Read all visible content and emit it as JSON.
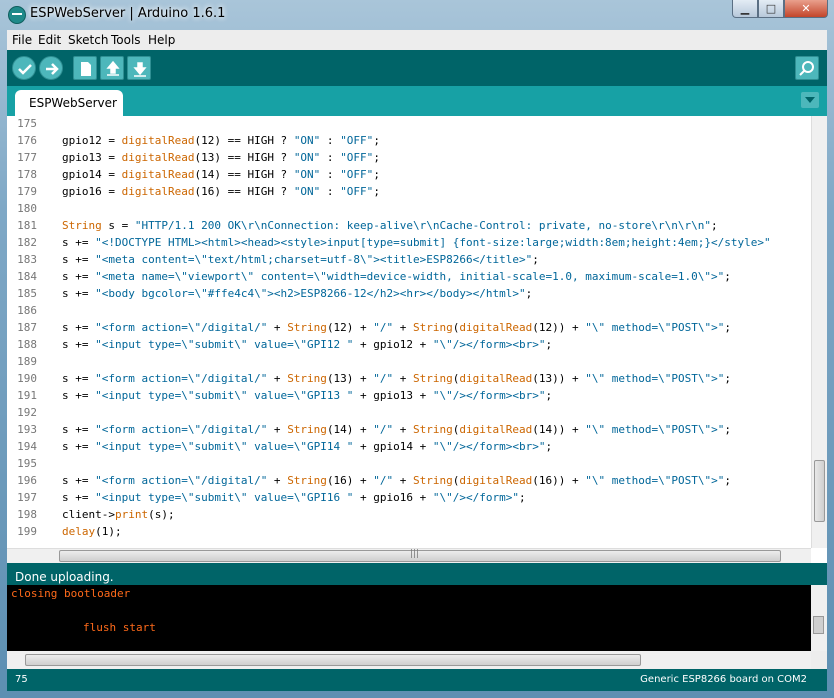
{
  "window": {
    "title": "ESPWebServer | Arduino 1.6.1"
  },
  "menu": [
    "File",
    "Edit",
    "Sketch",
    "Tools",
    "Help"
  ],
  "tab": {
    "label": "ESPWebServer"
  },
  "code_lines": [
    {
      "n": "175",
      "t": ""
    },
    {
      "n": "176",
      "t": "gpio12 = digitalRead(12) == HIGH ? \"ON\" : \"OFF\";"
    },
    {
      "n": "177",
      "t": "gpio13 = digitalRead(13) == HIGH ? \"ON\" : \"OFF\";"
    },
    {
      "n": "178",
      "t": "gpio14 = digitalRead(14) == HIGH ? \"ON\" : \"OFF\";"
    },
    {
      "n": "179",
      "t": "gpio16 = digitalRead(16) == HIGH ? \"ON\" : \"OFF\";"
    },
    {
      "n": "180",
      "t": ""
    },
    {
      "n": "181",
      "t": "String s = \"HTTP/1.1 200 OK\\r\\nConnection: keep-alive\\r\\nCache-Control: private, no-store\\r\\n\\r\\n\";"
    },
    {
      "n": "182",
      "t": "s += \"<!DOCTYPE HTML><html><head><style>input[type=submit] {font-size:large;width:8em;height:4em;}</style>\""
    },
    {
      "n": "183",
      "t": "s += \"<meta content=\\\"text/html;charset=utf-8\\\"><title>ESP8266</title>\";"
    },
    {
      "n": "184",
      "t": "s += \"<meta name=\\\"viewport\\\" content=\\\"width=device-width, initial-scale=1.0, maximum-scale=1.0\\\">\";"
    },
    {
      "n": "185",
      "t": "s += \"<body bgcolor=\\\"#ffe4c4\\\"><h2>ESP8266-12</h2><hr></body></html>\";"
    },
    {
      "n": "186",
      "t": ""
    },
    {
      "n": "187",
      "t": "s += \"<form action=\\\"/digital/\" + String(12) + \"/\" + String(digitalRead(12)) + \"\\\" method=\\\"POST\\\">\";"
    },
    {
      "n": "188",
      "t": "s += \"<input type=\\\"submit\\\" value=\\\"GPI12 \" + gpio12 + \"\\\"/></form><br>\";"
    },
    {
      "n": "189",
      "t": ""
    },
    {
      "n": "190",
      "t": "s += \"<form action=\\\"/digital/\" + String(13) + \"/\" + String(digitalRead(13)) + \"\\\" method=\\\"POST\\\">\";"
    },
    {
      "n": "191",
      "t": "s += \"<input type=\\\"submit\\\" value=\\\"GPI13 \" + gpio13 + \"\\\"/></form><br>\";"
    },
    {
      "n": "192",
      "t": ""
    },
    {
      "n": "193",
      "t": "s += \"<form action=\\\"/digital/\" + String(14) + \"/\" + String(digitalRead(14)) + \"\\\" method=\\\"POST\\\">\";"
    },
    {
      "n": "194",
      "t": "s += \"<input type=\\\"submit\\\" value=\\\"GPI14 \" + gpio14 + \"\\\"/></form><br>\";"
    },
    {
      "n": "195",
      "t": ""
    },
    {
      "n": "196",
      "t": "s += \"<form action=\\\"/digital/\" + String(16) + \"/\" + String(digitalRead(16)) + \"\\\" method=\\\"POST\\\">\";"
    },
    {
      "n": "197",
      "t": "s += \"<input type=\\\"submit\\\" value=\\\"GPI16 \" + gpio16 + \"\\\"/></form>\";"
    },
    {
      "n": "198",
      "t": "client->print(s);"
    },
    {
      "n": "199",
      "t": "delay(1);"
    }
  ],
  "status": "Done uploading.",
  "console": [
    "closing bootloader",
    "flush start"
  ],
  "footer": {
    "line": "75",
    "board": "Generic ESP8266 board on COM2"
  },
  "icons": [
    "verify-icon",
    "upload-icon",
    "new-icon",
    "open-icon",
    "save-icon",
    "serial-monitor-icon",
    "tab-menu-icon",
    "app-icon"
  ],
  "colors": {
    "toolbar": "#006468",
    "tabbar": "#17a1a5",
    "keyword": "#cc6600",
    "string": "#006699",
    "console_text": "#ff6a1a"
  }
}
